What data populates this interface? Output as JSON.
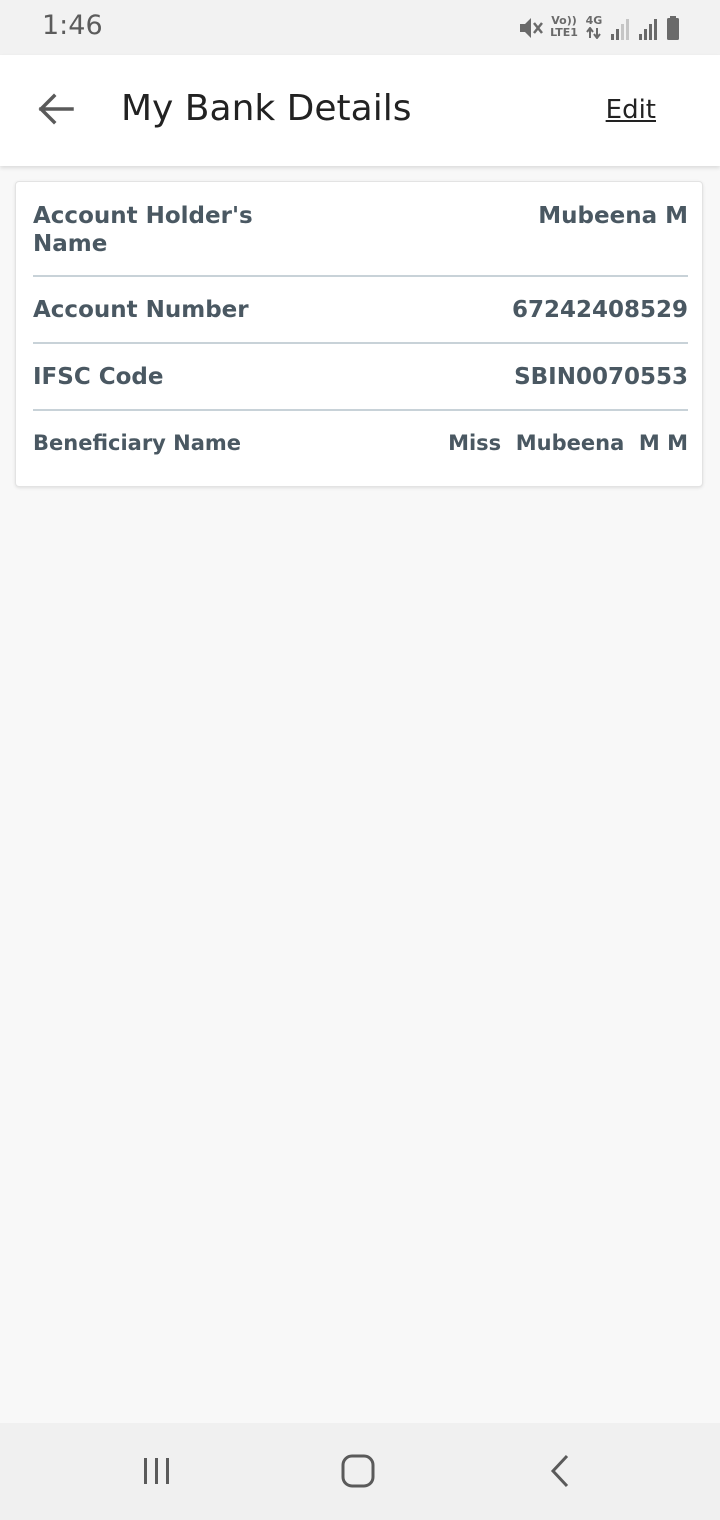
{
  "status_bar": {
    "time": "1:46",
    "volte_top": "Vo))",
    "volte_bottom": "LTE1",
    "network_type": "4G",
    "icons": [
      "mute-icon",
      "volte-icon",
      "data-arrows-icon",
      "signal-icon",
      "signal-icon",
      "battery-icon"
    ]
  },
  "header": {
    "title": "My Bank Details",
    "edit_label": "Edit",
    "back_icon": "arrow-left-icon"
  },
  "bank_details": {
    "rows": [
      {
        "label": "Account Holder's\nName",
        "value": "Mubeena M"
      },
      {
        "label": "Account Number",
        "value": "67242408529"
      },
      {
        "label": "IFSC Code",
        "value": "SBIN0070553"
      },
      {
        "label": "Beneficiary Name",
        "value": "Miss  Mubeena  M M"
      }
    ]
  },
  "nav_bar": {
    "icons": [
      "recent-apps-icon",
      "home-icon",
      "back-icon"
    ]
  }
}
